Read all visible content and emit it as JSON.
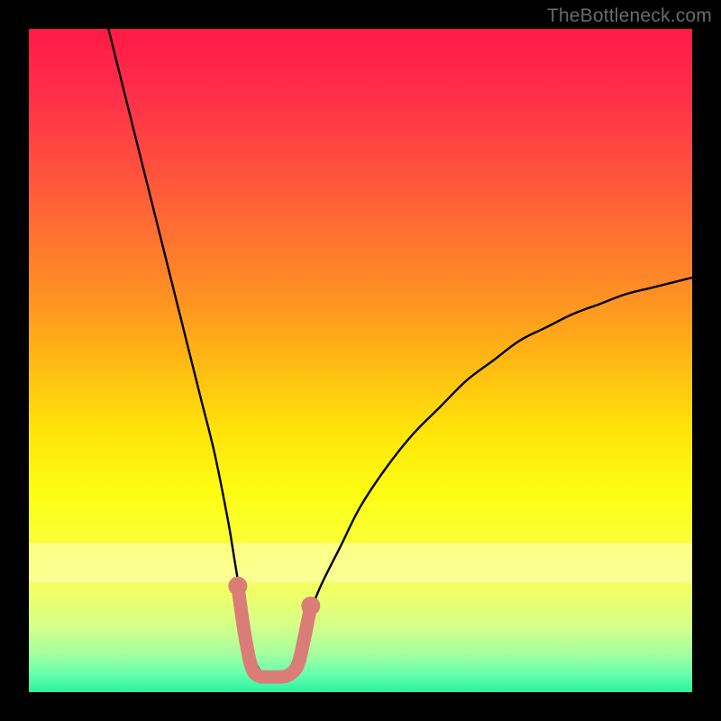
{
  "watermark": {
    "text": "TheBottleneck.com"
  },
  "gradient": {
    "stops": [
      {
        "offset": 0.0,
        "color": "#ff1a47"
      },
      {
        "offset": 0.1,
        "color": "#ff2f49"
      },
      {
        "offset": 0.2,
        "color": "#ff4d3f"
      },
      {
        "offset": 0.3,
        "color": "#ff6e33"
      },
      {
        "offset": 0.4,
        "color": "#ff9023"
      },
      {
        "offset": 0.5,
        "color": "#ffb814"
      },
      {
        "offset": 0.6,
        "color": "#ffe20a"
      },
      {
        "offset": 0.7,
        "color": "#fdfd12"
      },
      {
        "offset": 0.78,
        "color": "#f8ff3a"
      },
      {
        "offset": 0.85,
        "color": "#f0ff66"
      },
      {
        "offset": 0.9,
        "color": "#d4ff8a"
      },
      {
        "offset": 0.94,
        "color": "#a8ff9e"
      },
      {
        "offset": 0.97,
        "color": "#6cffad"
      },
      {
        "offset": 1.0,
        "color": "#2cf3a0"
      }
    ],
    "pale_band": {
      "y_top_frac": 0.775,
      "y_bottom_frac": 0.835,
      "color": "#ffffc2",
      "opacity": 0.55
    }
  },
  "chart_data": {
    "type": "line",
    "title": "",
    "xlabel": "",
    "ylabel": "",
    "xlim": [
      0,
      100
    ],
    "ylim": [
      0,
      100
    ],
    "x": [
      12,
      14,
      16,
      18,
      20,
      22,
      24,
      26,
      28,
      30,
      31,
      32,
      33,
      34,
      35,
      36,
      37,
      38,
      39,
      40,
      41,
      42,
      44,
      47,
      50,
      54,
      58,
      62,
      66,
      70,
      74,
      78,
      82,
      86,
      90,
      94,
      98,
      100
    ],
    "series": [
      {
        "name": "bottleneck-curve",
        "values": [
          100,
          92,
          84,
          76,
          68,
          60,
          52,
          44,
          36,
          26,
          20,
          14,
          9,
          5,
          3,
          2,
          2,
          2,
          3,
          5,
          8,
          11,
          16,
          22,
          28,
          34,
          39,
          43,
          47,
          50,
          53,
          55,
          57,
          58.5,
          60,
          61,
          62,
          62.5
        ]
      }
    ],
    "highlight": {
      "name": "optimal-range-marker",
      "color": "#da7d78",
      "points": [
        {
          "x": 31.5,
          "y": 16
        },
        {
          "x": 32.5,
          "y": 9
        },
        {
          "x": 33.5,
          "y": 4
        },
        {
          "x": 34.5,
          "y": 2.5
        },
        {
          "x": 36.0,
          "y": 2.3
        },
        {
          "x": 37.5,
          "y": 2.3
        },
        {
          "x": 39.0,
          "y": 2.5
        },
        {
          "x": 40.5,
          "y": 4
        },
        {
          "x": 41.5,
          "y": 8
        },
        {
          "x": 42.5,
          "y": 13
        }
      ]
    }
  }
}
